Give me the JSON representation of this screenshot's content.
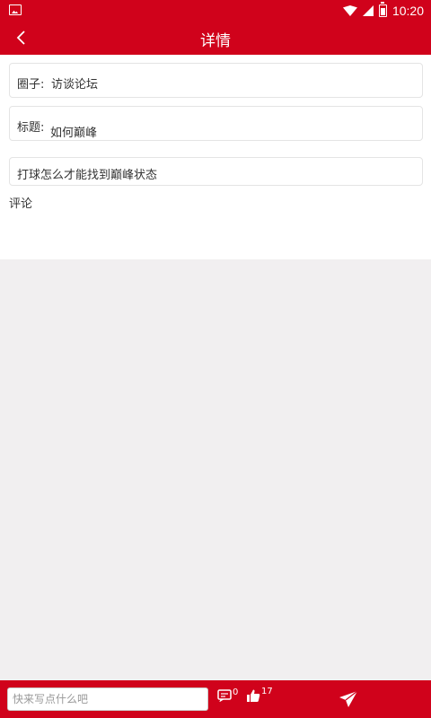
{
  "status_bar": {
    "time": "10:20"
  },
  "header": {
    "title": "详情"
  },
  "detail": {
    "circle_label": "圈子:",
    "circle_value": "访谈论坛",
    "title_label": "标题:",
    "title_value": "如何巅峰",
    "content": "打球怎么才能找到巅峰状态",
    "comments_label": "评论"
  },
  "bottom_bar": {
    "input_placeholder": "快来写点什么吧",
    "comment_count": "0",
    "like_count": "17"
  },
  "colors": {
    "brand": "#d0021b",
    "background": "#f1eff0"
  }
}
